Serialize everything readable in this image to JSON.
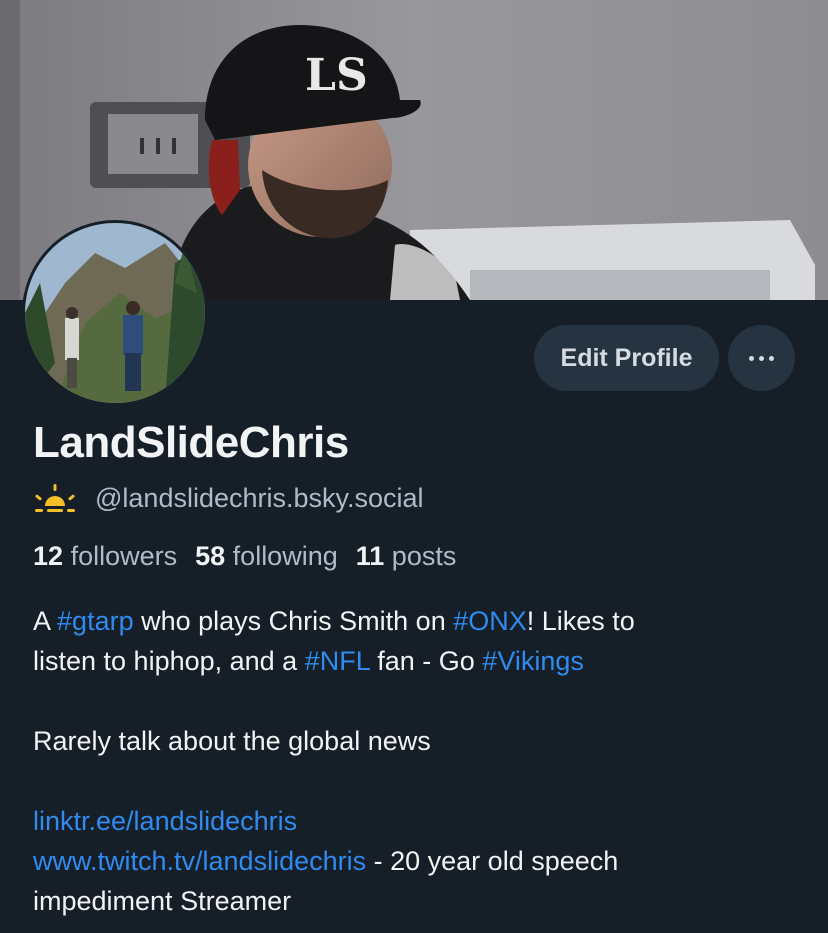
{
  "profile": {
    "display_name": "LandSlideChris",
    "handle": "@landslidechris.bsky.social",
    "handle_icon": "sun-icon",
    "stats": {
      "followers_count": "12",
      "followers_label": "followers",
      "following_count": "58",
      "following_label": "following",
      "posts_count": "11",
      "posts_label": "posts"
    },
    "bio": {
      "line1_a": "A ",
      "tag_gtarp": "#gtarp",
      "line1_b": " who plays Chris Smith on ",
      "tag_onx": "#ONX",
      "line1_c": "! Likes to",
      "line2_a": "listen to hiphop, and a ",
      "tag_nfl": "#NFL",
      "line2_b": " fan - Go ",
      "tag_vikings": "#Vikings",
      "line3": "Rarely talk about the global news",
      "link1": "linktr.ee/landslidechris",
      "link2": "www.twitch.tv/landslidechris",
      "line5_b": " - 20 year old speech",
      "line6": "impediment Streamer"
    }
  },
  "actions": {
    "edit_profile_label": "Edit Profile",
    "more_icon": "ellipsis-icon"
  },
  "colors": {
    "background": "#161e27",
    "button_bg": "#263341",
    "link": "#2f8bf0",
    "secondary_text": "#aebbc9",
    "sun_icon": "#f5bf2a"
  }
}
